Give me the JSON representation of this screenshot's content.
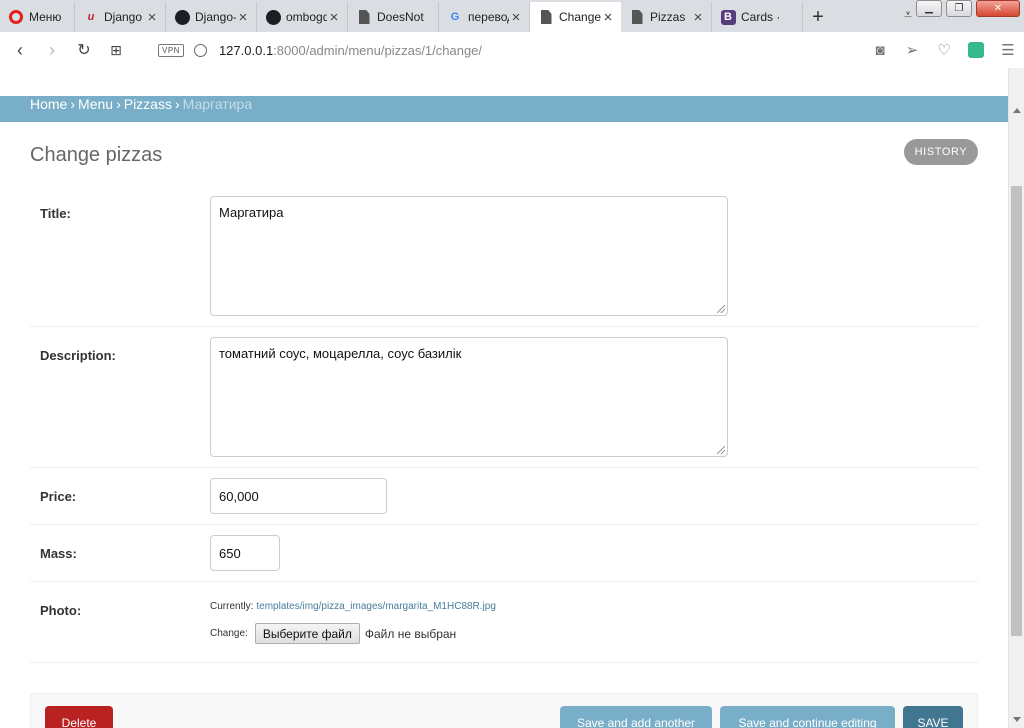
{
  "browser": {
    "tabs": [
      {
        "label": "Меню",
        "icon": "opera-icon"
      },
      {
        "label": "Django",
        "icon": "django-icon"
      },
      {
        "label": "Django-",
        "icon": "github-icon"
      },
      {
        "label": "ombogd",
        "icon": "github-icon"
      },
      {
        "label": "DoesNot",
        "icon": "document-icon"
      },
      {
        "label": "перевод",
        "icon": "google-icon"
      },
      {
        "label": "Change",
        "icon": "document-icon",
        "active": true
      },
      {
        "label": "Pizzas",
        "icon": "document-icon"
      },
      {
        "label": "Cards ·",
        "icon": "bootstrap-icon"
      }
    ],
    "vpn_label": "VPN",
    "url_host": "127.0.0.1",
    "url_rest": ":8000/admin/menu/pizzas/1/change/"
  },
  "breadcrumbs": {
    "home": "Home",
    "menu": "Menu",
    "model": "Pizzass",
    "current": "Маргатира"
  },
  "page": {
    "title": "Change pizzas",
    "history_label": "HISTORY"
  },
  "form": {
    "title_label": "Title:",
    "title_value": "Маргатира",
    "description_label": "Description:",
    "description_value": "томатний соус, моцарелла, соус базилік",
    "price_label": "Price:",
    "price_value": "60,000",
    "mass_label": "Mass:",
    "mass_value": "650",
    "photo_label": "Photo:",
    "currently_label": "Currently:",
    "currently_link": "templates/img/pizza_images/margarita_M1HC88R.jpg",
    "change_label": "Change:",
    "file_button": "Выберите файл",
    "no_file": "Файл не выбран"
  },
  "submit": {
    "delete_label": "Delete",
    "save_add_label": "Save and add another",
    "save_continue_label": "Save and continue editing",
    "save_label": "SAVE"
  },
  "colors": {
    "breadcrumb_bar": "#79aec8",
    "link": "#447e9b",
    "delete": "#ba2121",
    "save_default": "#417690"
  }
}
